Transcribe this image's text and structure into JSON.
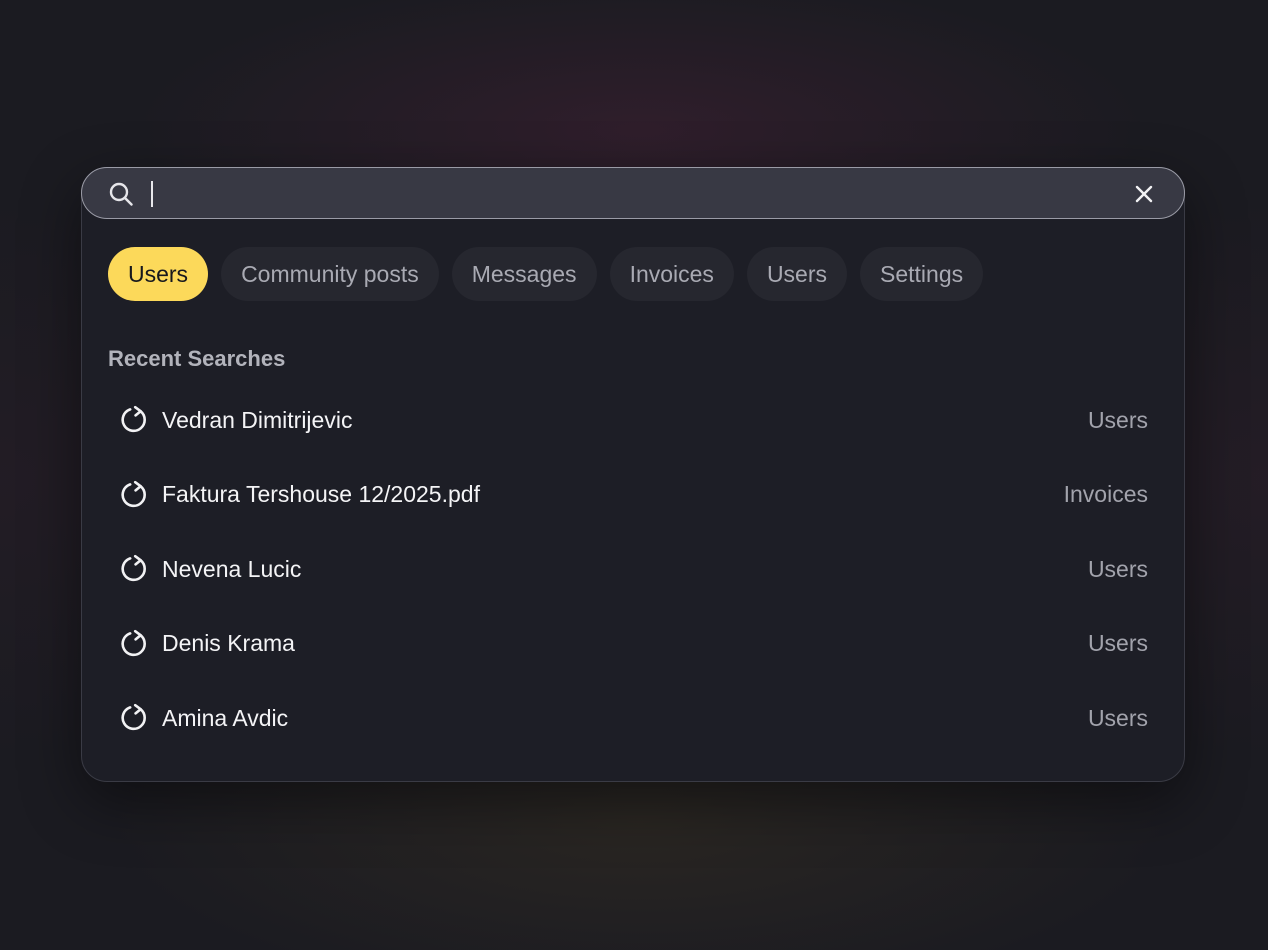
{
  "search": {
    "value": "",
    "placeholder": "",
    "search_icon": "search-icon",
    "clear_icon": "close-icon"
  },
  "filters": [
    {
      "label": "Users",
      "active": true
    },
    {
      "label": "Community posts",
      "active": false
    },
    {
      "label": "Messages",
      "active": false
    },
    {
      "label": "Invoices",
      "active": false
    },
    {
      "label": "Users",
      "active": false
    },
    {
      "label": "Settings",
      "active": false
    }
  ],
  "recent": {
    "title": "Recent Searches",
    "item_icon": "history-icon",
    "items": [
      {
        "label": "Vedran Dimitrijevic",
        "category": "Users"
      },
      {
        "label": "Faktura Tershouse 12/2025.pdf",
        "category": "Invoices"
      },
      {
        "label": "Nevena Lucic",
        "category": "Users"
      },
      {
        "label": "Denis Krama",
        "category": "Users"
      },
      {
        "label": "Amina Avdic",
        "category": "Users"
      }
    ]
  },
  "colors": {
    "accent": "#fcd95a",
    "panel": "#1d1e26",
    "search_bar": "#383944",
    "chip": "#26272f"
  }
}
